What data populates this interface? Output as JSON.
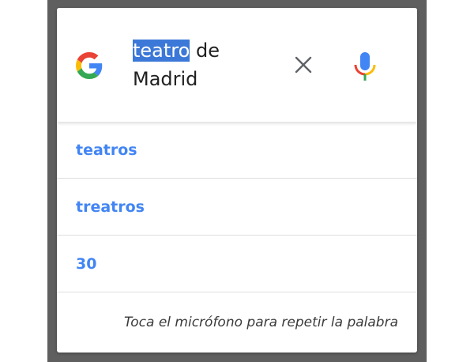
{
  "search": {
    "query_highlighted": "teatro",
    "query_rest_line1": " de",
    "query_line2": "Madrid"
  },
  "icons": {
    "logo": "google-g-icon",
    "clear": "close-icon",
    "mic": "microphone-icon"
  },
  "suggestions": [
    {
      "label": "teatros"
    },
    {
      "label": "treatros"
    },
    {
      "label": "30"
    }
  ],
  "hint": "Toca el micrófono para repetir la palabra",
  "colors": {
    "accent": "#4285f4",
    "selection": "#3c78d8",
    "backdrop": "#5f5f5f"
  }
}
